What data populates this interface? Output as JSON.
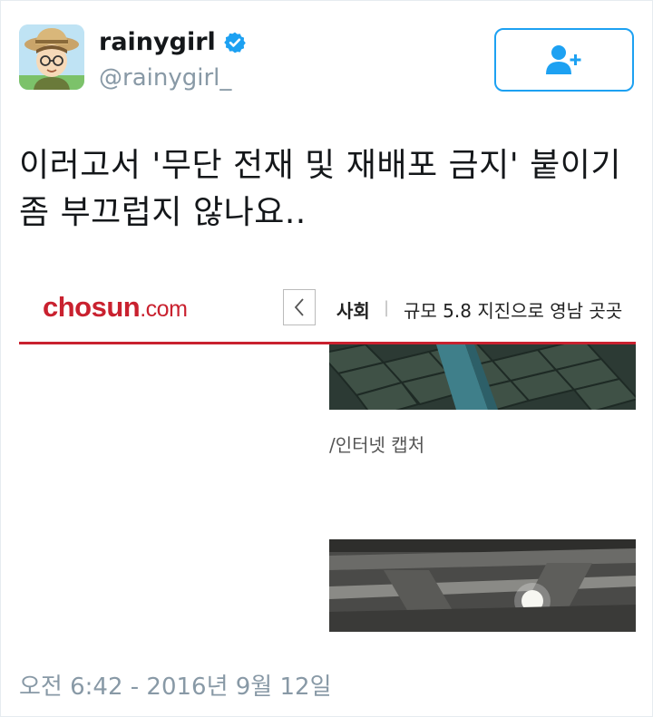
{
  "user": {
    "display_name": "rainygirl",
    "handle": "@rainygirl_",
    "verified_icon": "verified-badge-icon",
    "avatar_icon": "cartoon-avatar-icon"
  },
  "follow_button": {
    "icon": "add-user-icon"
  },
  "tweet": {
    "text_line1": "이러고서 '무단 전재 및 재배포 금지' 붙이기",
    "text_line2": "좀 부끄럽지 않나요..",
    "timestamp": "오전 6:42 - 2016년 9월 12일"
  },
  "embedded_screenshot": {
    "logo_main": "chosun",
    "logo_suffix": ".com",
    "back_icon": "chevron-left-icon",
    "section": "사회",
    "separator": "|",
    "headline": "규모 5.8 지진으로 영남 곳곳",
    "caption": "/인터넷 캡처"
  },
  "colors": {
    "brand_blue": "#1da1f2",
    "chosun_red": "#c9212f",
    "secondary_text": "#8899a6"
  }
}
